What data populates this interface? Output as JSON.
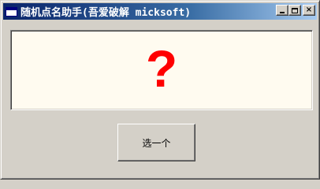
{
  "window": {
    "title": "随机点名助手(吾爱破解 micksoft)",
    "minimize_label": "_",
    "maximize_label": "□",
    "close_label": "×"
  },
  "display": {
    "value": "?",
    "color": "#ff0000",
    "background": "#fffbf0"
  },
  "pick_button": {
    "label": "选一个"
  },
  "icons": {
    "app": "window-icon",
    "minimize": "minimize-icon",
    "maximize": "maximize-icon",
    "close": "close-icon"
  }
}
